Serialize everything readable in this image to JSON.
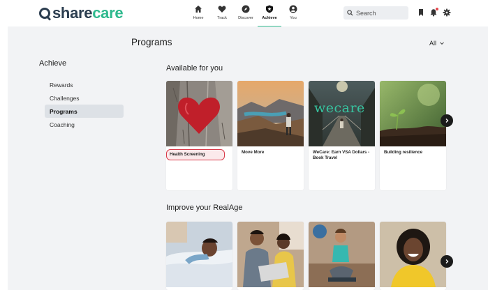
{
  "brand": {
    "share": "share",
    "care": "care"
  },
  "nav": [
    {
      "label": "Home",
      "icon": "home-icon"
    },
    {
      "label": "Track",
      "icon": "heart-icon"
    },
    {
      "label": "Discover",
      "icon": "compass-icon"
    },
    {
      "label": "Achieve",
      "icon": "shield-icon",
      "active": true
    },
    {
      "label": "You",
      "icon": "user-icon"
    }
  ],
  "search": {
    "placeholder": "Search"
  },
  "header_icons": [
    "bookmark-icon",
    "notification-icon",
    "gear-icon"
  ],
  "page": {
    "title": "Programs",
    "filter": "All"
  },
  "sidebar": {
    "title": "Achieve",
    "items": [
      {
        "label": "Rewards"
      },
      {
        "label": "Challenges"
      },
      {
        "label": "Programs",
        "active": true
      },
      {
        "label": "Coaching"
      }
    ]
  },
  "sections": [
    {
      "title": "Available for you",
      "cards": [
        {
          "label": "Health Screening",
          "highlighted": true
        },
        {
          "label": "Move More"
        },
        {
          "label": "WeCare: Earn VSA Dollars - Book Travel",
          "image_text": "wecare"
        },
        {
          "label": "Building resilience"
        }
      ]
    },
    {
      "title": "Improve your RealAge",
      "cards": [
        {
          "label": ""
        },
        {
          "label": ""
        },
        {
          "label": ""
        },
        {
          "label": ""
        }
      ]
    }
  ],
  "colors": {
    "brand_green": "#2fb98e",
    "brand_navy": "#2c3e50",
    "highlight_red": "#d93b4a",
    "page_bg": "#f2f3f5"
  }
}
